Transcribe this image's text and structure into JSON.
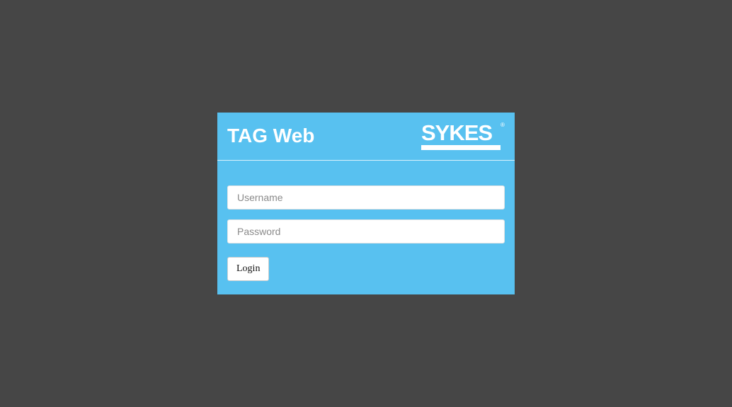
{
  "app": {
    "title": "TAG Web"
  },
  "logo": {
    "text": "SYKES",
    "registered_mark": "®"
  },
  "form": {
    "username": {
      "value": "",
      "placeholder": "Username"
    },
    "password": {
      "value": "",
      "placeholder": "Password"
    },
    "login_label": "Login"
  },
  "colors": {
    "page_background": "#464646",
    "panel_background": "#58c1f0",
    "text_light": "#ffffff"
  }
}
